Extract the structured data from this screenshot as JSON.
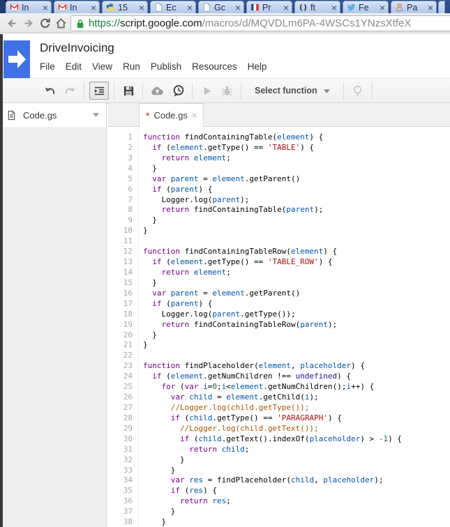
{
  "browser": {
    "tabs": [
      {
        "icon": "gmail-icon",
        "label": "In"
      },
      {
        "icon": "gmail-icon",
        "label": "In"
      },
      {
        "icon": "python-icon",
        "label": "15"
      },
      {
        "icon": "page-icon",
        "label": "Ec"
      },
      {
        "icon": "page-icon",
        "label": "Gc"
      },
      {
        "icon": "flag-icon",
        "label": "Pr"
      },
      {
        "icon": "github-icon",
        "label": "ft"
      },
      {
        "icon": "twitter-icon",
        "label": "Fe"
      },
      {
        "icon": "stack-icon",
        "label": "Pa"
      }
    ],
    "tab_close_glyph": "×",
    "nav": {
      "url_scheme": "https://",
      "url_host": "script.google.com",
      "url_path": "/macros/d/MQVDLm6PA-4WSCs1YNzsXtfeX"
    }
  },
  "header": {
    "title": "DriveInvoicing",
    "menus": [
      "File",
      "Edit",
      "View",
      "Run",
      "Publish",
      "Resources",
      "Help"
    ]
  },
  "toolbar": {
    "select_function_label": "Select function"
  },
  "sidebar": {
    "files": [
      {
        "name": "Code.gs"
      }
    ]
  },
  "editor": {
    "tab_name": "Code.gs",
    "dirty_marker": "*",
    "close_glyph": "×",
    "colors": {
      "keyword": "#770088",
      "variable": "#0055aa",
      "string": "#aa1111",
      "comment": "#aa5500",
      "number": "#116644",
      "atom": "#221199",
      "plain": "#000000"
    },
    "lines": [
      {
        "n": 1,
        "tokens": [
          [
            "k",
            "function"
          ],
          [
            "p",
            " findContainingTable("
          ],
          [
            "v",
            "element"
          ],
          [
            "p",
            ") {"
          ]
        ]
      },
      {
        "n": 2,
        "tokens": [
          [
            "p",
            "  "
          ],
          [
            "k",
            "if"
          ],
          [
            "p",
            " ("
          ],
          [
            "v",
            "element"
          ],
          [
            "p",
            ".getType() == "
          ],
          [
            "s",
            "'TABLE'"
          ],
          [
            "p",
            ") {"
          ]
        ]
      },
      {
        "n": 3,
        "tokens": [
          [
            "p",
            "    "
          ],
          [
            "k",
            "return"
          ],
          [
            "p",
            " "
          ],
          [
            "v",
            "element"
          ],
          [
            "p",
            ";"
          ]
        ]
      },
      {
        "n": 4,
        "tokens": [
          [
            "p",
            "  }"
          ]
        ]
      },
      {
        "n": 5,
        "tokens": [
          [
            "p",
            "  "
          ],
          [
            "k",
            "var"
          ],
          [
            "p",
            " "
          ],
          [
            "v",
            "parent"
          ],
          [
            "p",
            " = "
          ],
          [
            "v",
            "element"
          ],
          [
            "p",
            ".getParent()"
          ]
        ]
      },
      {
        "n": 6,
        "tokens": [
          [
            "p",
            "  "
          ],
          [
            "k",
            "if"
          ],
          [
            "p",
            " ("
          ],
          [
            "v",
            "parent"
          ],
          [
            "p",
            ") {"
          ]
        ]
      },
      {
        "n": 7,
        "tokens": [
          [
            "p",
            "    Logger.log("
          ],
          [
            "v",
            "parent"
          ],
          [
            "p",
            ");"
          ]
        ]
      },
      {
        "n": 8,
        "tokens": [
          [
            "p",
            "    "
          ],
          [
            "k",
            "return"
          ],
          [
            "p",
            " findContainingTable("
          ],
          [
            "v",
            "parent"
          ],
          [
            "p",
            ");"
          ]
        ]
      },
      {
        "n": 9,
        "tokens": [
          [
            "p",
            "  }"
          ]
        ]
      },
      {
        "n": 10,
        "tokens": [
          [
            "p",
            "}"
          ]
        ]
      },
      {
        "n": 11,
        "tokens": []
      },
      {
        "n": 12,
        "tokens": [
          [
            "k",
            "function"
          ],
          [
            "p",
            " findContainingTableRow("
          ],
          [
            "v",
            "element"
          ],
          [
            "p",
            ") {"
          ]
        ]
      },
      {
        "n": 13,
        "tokens": [
          [
            "p",
            "  "
          ],
          [
            "k",
            "if"
          ],
          [
            "p",
            " ("
          ],
          [
            "v",
            "element"
          ],
          [
            "p",
            ".getType() == "
          ],
          [
            "s",
            "'TABLE_ROW'"
          ],
          [
            "p",
            ") {"
          ]
        ]
      },
      {
        "n": 14,
        "tokens": [
          [
            "p",
            "    "
          ],
          [
            "k",
            "return"
          ],
          [
            "p",
            " "
          ],
          [
            "v",
            "element"
          ],
          [
            "p",
            ";"
          ]
        ]
      },
      {
        "n": 15,
        "tokens": [
          [
            "p",
            "  }"
          ]
        ]
      },
      {
        "n": 16,
        "tokens": [
          [
            "p",
            "  "
          ],
          [
            "k",
            "var"
          ],
          [
            "p",
            " "
          ],
          [
            "v",
            "parent"
          ],
          [
            "p",
            " = "
          ],
          [
            "v",
            "element"
          ],
          [
            "p",
            ".getParent()"
          ]
        ]
      },
      {
        "n": 17,
        "tokens": [
          [
            "p",
            "  "
          ],
          [
            "k",
            "if"
          ],
          [
            "p",
            " ("
          ],
          [
            "v",
            "parent"
          ],
          [
            "p",
            ") {"
          ]
        ]
      },
      {
        "n": 18,
        "tokens": [
          [
            "p",
            "    Logger.log("
          ],
          [
            "v",
            "parent"
          ],
          [
            "p",
            ".getType());"
          ]
        ]
      },
      {
        "n": 19,
        "tokens": [
          [
            "p",
            "    "
          ],
          [
            "k",
            "return"
          ],
          [
            "p",
            " findContainingTableRow("
          ],
          [
            "v",
            "parent"
          ],
          [
            "p",
            ");"
          ]
        ]
      },
      {
        "n": 20,
        "tokens": [
          [
            "p",
            "  }"
          ]
        ]
      },
      {
        "n": 21,
        "tokens": [
          [
            "p",
            "}"
          ]
        ]
      },
      {
        "n": 22,
        "tokens": []
      },
      {
        "n": 23,
        "tokens": [
          [
            "k",
            "function"
          ],
          [
            "p",
            " findPlaceholder("
          ],
          [
            "v",
            "element"
          ],
          [
            "p",
            ", "
          ],
          [
            "v",
            "placeholder"
          ],
          [
            "p",
            ") {"
          ]
        ]
      },
      {
        "n": 24,
        "tokens": [
          [
            "p",
            "  "
          ],
          [
            "k",
            "if"
          ],
          [
            "p",
            " ("
          ],
          [
            "v",
            "element"
          ],
          [
            "p",
            ".getNumChildren !== "
          ],
          [
            "a",
            "undefined"
          ],
          [
            "p",
            ") {"
          ]
        ]
      },
      {
        "n": 25,
        "tokens": [
          [
            "p",
            "    "
          ],
          [
            "k",
            "for"
          ],
          [
            "p",
            " ("
          ],
          [
            "k",
            "var"
          ],
          [
            "p",
            " "
          ],
          [
            "v",
            "i"
          ],
          [
            "p",
            "="
          ],
          [
            "n",
            "0"
          ],
          [
            "p",
            ";"
          ],
          [
            "v",
            "i"
          ],
          [
            "p",
            "<"
          ],
          [
            "v",
            "element"
          ],
          [
            "p",
            ".getNumChildren();"
          ],
          [
            "v",
            "i"
          ],
          [
            "p",
            "++) {"
          ]
        ]
      },
      {
        "n": 26,
        "tokens": [
          [
            "p",
            "      "
          ],
          [
            "k",
            "var"
          ],
          [
            "p",
            " "
          ],
          [
            "v",
            "child"
          ],
          [
            "p",
            " = "
          ],
          [
            "v",
            "element"
          ],
          [
            "p",
            ".getChild("
          ],
          [
            "v",
            "i"
          ],
          [
            "p",
            ");"
          ]
        ]
      },
      {
        "n": 27,
        "tokens": [
          [
            "p",
            "      "
          ],
          [
            "c",
            "//Logger.log(child.getType());"
          ]
        ]
      },
      {
        "n": 28,
        "tokens": [
          [
            "p",
            "      "
          ],
          [
            "k",
            "if"
          ],
          [
            "p",
            " ("
          ],
          [
            "v",
            "child"
          ],
          [
            "p",
            ".getType() == "
          ],
          [
            "s",
            "'PARAGRAPH'"
          ],
          [
            "p",
            ") {"
          ]
        ]
      },
      {
        "n": 29,
        "tokens": [
          [
            "p",
            "        "
          ],
          [
            "c",
            "//Logger.log(child.getText());"
          ]
        ]
      },
      {
        "n": 30,
        "tokens": [
          [
            "p",
            "        "
          ],
          [
            "k",
            "if"
          ],
          [
            "p",
            " ("
          ],
          [
            "v",
            "child"
          ],
          [
            "p",
            ".getText().indexOf("
          ],
          [
            "v",
            "placeholder"
          ],
          [
            "p",
            ") > "
          ],
          [
            "n",
            "-1"
          ],
          [
            "p",
            ") {"
          ]
        ]
      },
      {
        "n": 31,
        "tokens": [
          [
            "p",
            "          "
          ],
          [
            "k",
            "return"
          ],
          [
            "p",
            " "
          ],
          [
            "v",
            "child"
          ],
          [
            "p",
            ";"
          ]
        ]
      },
      {
        "n": 32,
        "tokens": [
          [
            "p",
            "        }"
          ]
        ]
      },
      {
        "n": 33,
        "tokens": [
          [
            "p",
            "      }"
          ]
        ]
      },
      {
        "n": 34,
        "tokens": [
          [
            "p",
            "      "
          ],
          [
            "k",
            "var"
          ],
          [
            "p",
            " "
          ],
          [
            "v",
            "res"
          ],
          [
            "p",
            " = findPlaceholder("
          ],
          [
            "v",
            "child"
          ],
          [
            "p",
            ", "
          ],
          [
            "v",
            "placeholder"
          ],
          [
            "p",
            ");"
          ]
        ]
      },
      {
        "n": 35,
        "tokens": [
          [
            "p",
            "      "
          ],
          [
            "k",
            "if"
          ],
          [
            "p",
            " ("
          ],
          [
            "v",
            "res"
          ],
          [
            "p",
            ") {"
          ]
        ]
      },
      {
        "n": 36,
        "tokens": [
          [
            "p",
            "        "
          ],
          [
            "k",
            "return"
          ],
          [
            "p",
            " "
          ],
          [
            "v",
            "res"
          ],
          [
            "p",
            ";"
          ]
        ]
      },
      {
        "n": 37,
        "tokens": [
          [
            "p",
            "      }"
          ]
        ]
      },
      {
        "n": 38,
        "tokens": [
          [
            "p",
            "    }"
          ]
        ]
      }
    ]
  }
}
